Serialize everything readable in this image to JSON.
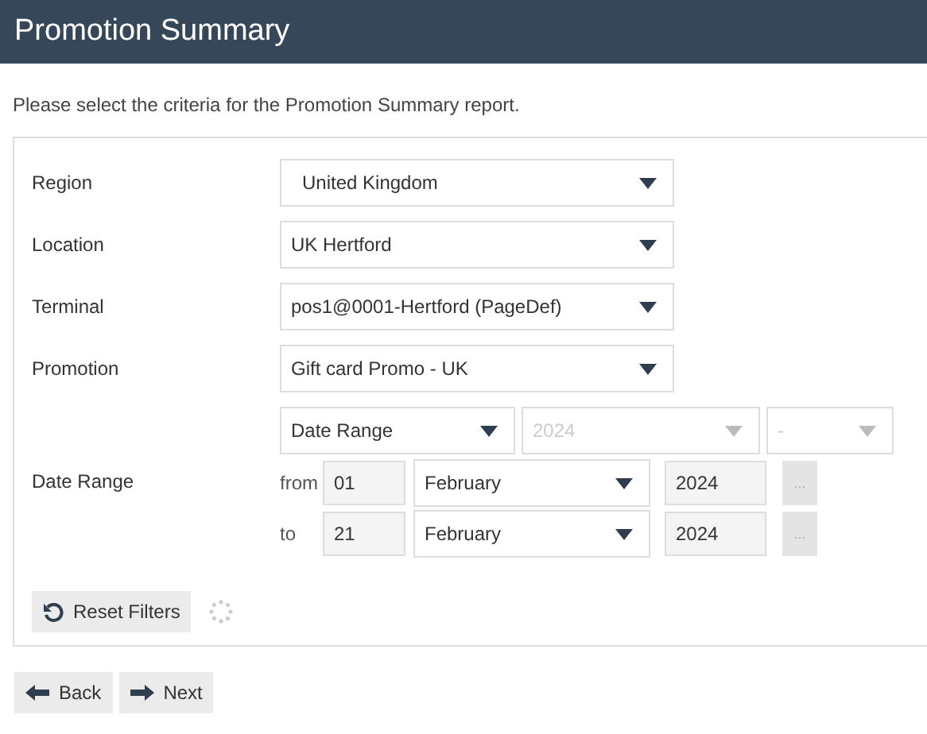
{
  "header": {
    "title": "Promotion Summary"
  },
  "intro": "Please select the criteria for the Promotion Summary report.",
  "fields": [
    {
      "label": "Region",
      "value": "United Kingdom"
    },
    {
      "label": "Location",
      "value": "UK Hertford"
    },
    {
      "label": "Terminal",
      "value": "pos1@0001-Hertford (PageDef)"
    },
    {
      "label": "Promotion",
      "value": "Gift card Promo - UK"
    }
  ],
  "date_range": {
    "label": "Date Range",
    "selects": [
      {
        "value": "Date Range",
        "disabled": false
      },
      {
        "value": "2024",
        "disabled": true
      },
      {
        "value": "-",
        "disabled": true
      }
    ],
    "rows": [
      {
        "label": "from",
        "day": "01",
        "month": "February",
        "year": "2024",
        "picker": "...",
        "picker_disabled": true
      },
      {
        "label": "to",
        "day": "21",
        "month": "February",
        "year": "2024",
        "picker": "...",
        "picker_disabled": true
      }
    ]
  },
  "reset_button": "Reset Filters",
  "loading": true,
  "nav_buttons": [
    {
      "label": "Back",
      "kind": "back"
    },
    {
      "label": "Next",
      "kind": "next"
    }
  ]
}
